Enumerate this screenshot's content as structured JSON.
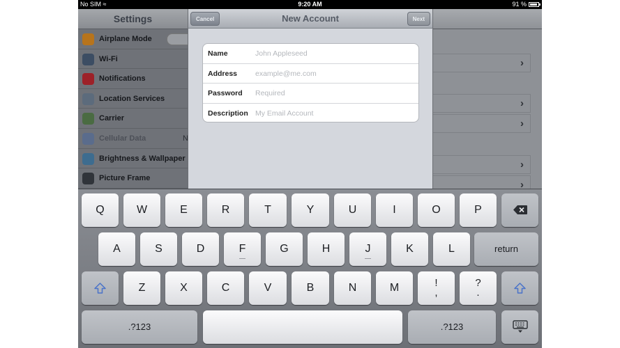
{
  "status": {
    "carrier": "No SIM",
    "time": "9:20 AM",
    "battery": "91 %"
  },
  "sidebar": {
    "title": "Settings",
    "items": [
      {
        "label": "Airplane Mode",
        "icon": "airplane-icon",
        "color": "#d48a1e"
      },
      {
        "label": "Wi-Fi",
        "icon": "wifi-icon",
        "color": "#3c4d63"
      },
      {
        "label": "Notifications",
        "icon": "notifications-icon",
        "color": "#b3252c"
      },
      {
        "label": "Location Services",
        "icon": "location-icon",
        "color": "#5c6b7c"
      },
      {
        "label": "Carrier",
        "icon": "phone-icon",
        "color": "#4a6b42"
      },
      {
        "label": "Cellular Data",
        "icon": "cellular-icon",
        "color": "#5a6c8c",
        "extra": "N"
      },
      {
        "label": "Brightness & Wallpaper",
        "icon": "brightness-icon",
        "color": "#3d6c8f"
      },
      {
        "label": "Picture Frame",
        "icon": "picture-frame-icon",
        "color": "#30343a"
      }
    ]
  },
  "modal": {
    "title": "New Account",
    "cancel_label": "Cancel",
    "next_label": "Next",
    "fields": [
      {
        "label": "Name",
        "placeholder": "John Appleseed",
        "value": ""
      },
      {
        "label": "Address",
        "placeholder": "example@me.com",
        "value": ""
      },
      {
        "label": "Password",
        "placeholder": "Required",
        "value": ""
      },
      {
        "label": "Description",
        "placeholder": "My Email Account",
        "value": ""
      }
    ]
  },
  "detail": {
    "chevron": "›"
  },
  "keyboard": {
    "row1": [
      "Q",
      "W",
      "E",
      "R",
      "T",
      "Y",
      "U",
      "I",
      "O",
      "P"
    ],
    "row2": [
      "A",
      "S",
      "D",
      "F",
      "G",
      "H",
      "J",
      "K",
      "L"
    ],
    "row3": [
      "Z",
      "X",
      "C",
      "V",
      "B",
      "N",
      "M"
    ],
    "return_label": "return",
    "numbers_label": ".?123",
    "exclaim_top": "!",
    "exclaim_bottom": ",",
    "question_top": "?",
    "question_bottom": "."
  }
}
